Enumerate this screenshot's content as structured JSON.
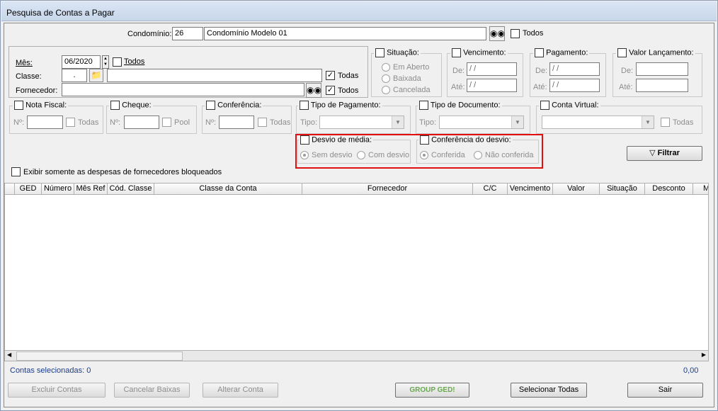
{
  "window": {
    "title": "Pesquisa de Contas a Pagar"
  },
  "condominio": {
    "label": "Condomínio:",
    "code": "26",
    "name": "Condomínio Modelo 01",
    "todos_label": "Todos"
  },
  "filters": {
    "mes_label": "Mês:",
    "mes_value": "06/2020",
    "mes_todos": "Todos",
    "classe_label": "Classe:",
    "classe_value": ".",
    "classe_todas": "Todas",
    "fornecedor_label": "Fornecedor:",
    "fornecedor_todos": "Todos",
    "exibir_label": "Exibir somente as despesas de fornecedores bloqueados"
  },
  "situacao": {
    "title": "Situação:",
    "options": [
      "Em Aberto",
      "Baixada",
      "Cancelada"
    ]
  },
  "vencimento": {
    "title": "Vencimento:",
    "de": "De:",
    "ate": "Até:",
    "de_value": " / /",
    "ate_value": " / /"
  },
  "pagamento": {
    "title": "Pagamento:",
    "de": "De:",
    "ate": "Até:",
    "de_value": " / /",
    "ate_value": " / /"
  },
  "valor_lancamento": {
    "title": "Valor Lançamento:",
    "de": "De:",
    "ate": "Até:"
  },
  "nota_fiscal": {
    "title": "Nota Fiscal:",
    "no": "Nº:",
    "todas": "Todas"
  },
  "cheque": {
    "title": "Cheque:",
    "no": "Nº:",
    "pool": "Pool"
  },
  "conferencia": {
    "title": "Conferência:",
    "no": "Nº:",
    "todas": "Todas"
  },
  "tipo_pagamento": {
    "title": "Tipo de Pagamento:",
    "tipo": "Tipo:"
  },
  "tipo_documento": {
    "title": "Tipo de Documento:",
    "tipo": "Tipo:"
  },
  "conta_virtual": {
    "title": "Conta Virtual:",
    "todas": "Todas"
  },
  "desvio_media": {
    "title": "Desvio de média:",
    "options": [
      "Sem desvio",
      "Com desvio"
    ]
  },
  "conferencia_desvio": {
    "title": "Conferência do desvio:",
    "options": [
      "Conferida",
      "Não conferida"
    ]
  },
  "filtrar_label": "Filtrar",
  "grid": {
    "columns": [
      "GED",
      "Número",
      "Mês Ref",
      "Cód. Classe",
      "Classe da Conta",
      "Fornecedor",
      "C/C",
      "Vencimento",
      "Valor",
      "Situação",
      "Desconto",
      "M"
    ]
  },
  "footer": {
    "selecionadas": "Contas selecionadas: 0",
    "total": "0,00",
    "buttons": [
      "Excluir Contas",
      "Cancelar Baixas",
      "Alterar Conta",
      "GROUP GED!",
      "Selecionar Todas",
      "Sair"
    ]
  },
  "colors": {
    "accent_text": "#1a3c8c",
    "highlight": "#e01010"
  }
}
